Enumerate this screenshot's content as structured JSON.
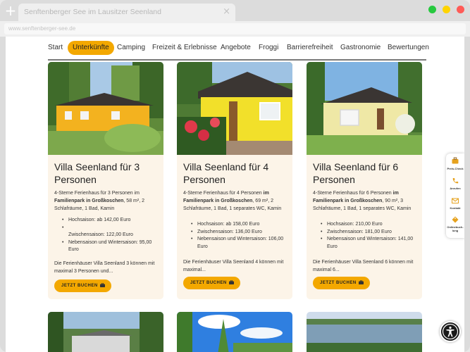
{
  "browser": {
    "new_tab_glyph": "+",
    "tab_title": "Senftenberger See im Lausitzer Seenland",
    "tab_close_glyph": "×",
    "url": "www.senftenberger-see.de",
    "traffic_colors": [
      "#27c93f",
      "#ffd400",
      "#ff5b57"
    ]
  },
  "nav": {
    "items": [
      "Start",
      "Unterkünfte",
      "Camping",
      "Freizeit & Erlebnisse",
      "Angebote",
      "Froggi",
      "Barrierefreiheit",
      "Gastronomie",
      "Bewertungen"
    ],
    "active_index": 1,
    "accent": "#f3a800"
  },
  "cards": [
    {
      "title": "Villa Seenland für 3 Personen",
      "desc_pre": "4-Sterne Ferienhaus für 3 Personen im ",
      "desc_bold": "Familienpark in Großkoschen",
      "desc_post": ", 58 m², 2 Schlafräume, 1 Bad, Kamin",
      "prices": [
        "Hochsaison: ab 142,00 Euro",
        "",
        "Zwischensaison: 122,00 Euro",
        "Nebensaison und Wintersaison: 95,00 Euro"
      ],
      "more": "Die Ferienhäuser Villa Seenland 3 können mit maximal 3 Personen und...",
      "button": "JETZT BUCHEN"
    },
    {
      "title": "Villa Seenland für 4 Personen",
      "desc_pre": "4-Sterne Ferienhaus für 4 Personen ",
      "desc_bold": "im Familienpark in Großkoschen",
      "desc_post": ", 69 m², 2 Schlafräume, 1 Bad, 1 separates WC, Kamin",
      "prices": [
        "Hochsaison: ab 158,00 Euro",
        "Zwischensaison: 136,00 Euro",
        "Nebensaison und Wintersaison: 106,00 Euro"
      ],
      "more": "Die Ferienhäuser Villa Seenland 4 können mit maximal...",
      "button": "JETZT BUCHEN"
    },
    {
      "title": "Villa Seenland für 6 Personen",
      "desc_pre": "4-Sterne Ferienhaus für 6 Personen ",
      "desc_bold": "im Familienpark in Großkoschen",
      "desc_post": ", 90 m², 3 Schlafräume, 1 Bad, 1 separates WC, Kamin",
      "prices": [
        "Hochsaison: 210,00 Euro",
        "Zwischensaison: 181,00 Euro",
        "Nebensaison und Wintersaison: 141,00 Euro"
      ],
      "more": "Die Ferienhäuser Villa Seenland 6 können mit maximal 6...",
      "button": "JETZT BUCHEN"
    }
  ],
  "side_widget": {
    "items": [
      {
        "icon": "suitcase-icon",
        "label1": "Preis-Check",
        "label2": ""
      },
      {
        "icon": "phone-icon",
        "label1": "Anrufen",
        "label2": ""
      },
      {
        "icon": "mail-icon",
        "label1": "Kontakt",
        "label2": ""
      },
      {
        "icon": "tag-icon",
        "label1": "Onlinebuch-",
        "label2": "lung"
      }
    ]
  },
  "accessibility_icon": "accessibility-icon"
}
